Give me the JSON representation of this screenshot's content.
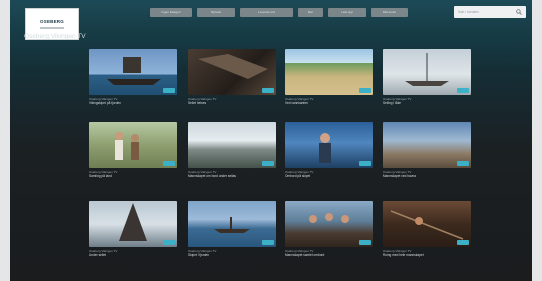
{
  "header": {
    "search_placeholder": "Søk i kanalen",
    "nav": [
      "Ingen kategori",
      "Nyheter",
      "Levende ord",
      "Mer",
      "Last opp",
      "Mitt konto"
    ]
  },
  "channel_title": "Oseberg Vikingen TV",
  "videos": [
    {
      "sub": "Oseberg Vikingen TV",
      "name": "Vikingskipet på fjorden"
    },
    {
      "sub": "Oseberg Vikingen TV",
      "name": "Seilet heises"
    },
    {
      "sub": "Oseberg Vikingen TV",
      "name": "Ved vannkanten"
    },
    {
      "sub": "Oseberg Vikingen TV",
      "name": "Seiling i tåke"
    },
    {
      "sub": "Oseberg Vikingen TV",
      "name": "Samling på land"
    },
    {
      "sub": "Oseberg Vikingen TV",
      "name": "Mannskapet om bord under seilas"
    },
    {
      "sub": "Oseberg Vikingen TV",
      "name": "Ombord på skipet"
    },
    {
      "sub": "Oseberg Vikingen TV",
      "name": "Mannskapet ved havna"
    },
    {
      "sub": "Oseberg Vikingen TV",
      "name": "Under seilet"
    },
    {
      "sub": "Oseberg Vikingen TV",
      "name": "Skipet i fjorden"
    },
    {
      "sub": "Oseberg Vikingen TV",
      "name": "Mannskapet samlet ombord"
    },
    {
      "sub": "Oseberg Vikingen TV",
      "name": "Roing med hele mannskapet"
    }
  ]
}
